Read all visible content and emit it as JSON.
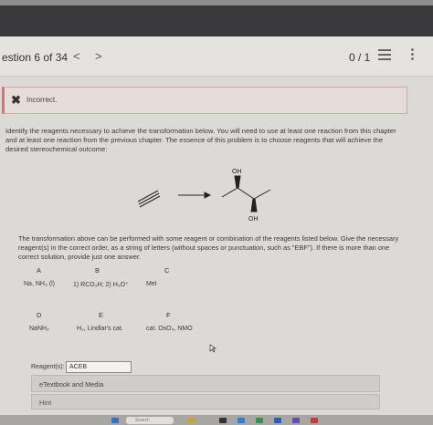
{
  "nav": {
    "question_title": "estion 6 of 34",
    "prev_glyph": "<",
    "next_glyph": ">",
    "score": "0 / 1",
    "more_glyph": "⋮"
  },
  "feedback": {
    "icon_glyph": "✖",
    "label": "Incorrect."
  },
  "prompt": "Identify the reagents necessary to achieve the transformation below. You will need to use at least one reaction from this chapter and at least one reaction from the previous chapter. The essence of this problem is to choose reagents that will achieve the desired stereochemical outcome:",
  "molecule": {
    "oh_top": "OH",
    "oh_bottom": "OH"
  },
  "transformation_text": "The transformation above can be performed with some reagent or combination of the reagents listed below. Give the necessary reagent(s) in the correct order, as a string of letters (without spaces or punctuation, such as \"EBF\"). If there is more than one correct solution, provide just one answer.",
  "reagents": [
    {
      "letter": "A",
      "text": "Na, NH₃ (l)"
    },
    {
      "letter": "B",
      "text": "1) RCO₃H; 2) H₃O⁺"
    },
    {
      "letter": "C",
      "text": "MeI"
    },
    {
      "letter": "D",
      "text": "NaNH₂"
    },
    {
      "letter": "E",
      "text": "H₂, Lindlar's cat."
    },
    {
      "letter": "F",
      "text": "cat. OsO₄, NMO"
    }
  ],
  "answer": {
    "label": "Reagent(s):",
    "value": "ACEB"
  },
  "etextbook_label": "eTextbook and Media",
  "hint_label": "Hint",
  "taskbar": {
    "search_placeholder": "Search"
  }
}
